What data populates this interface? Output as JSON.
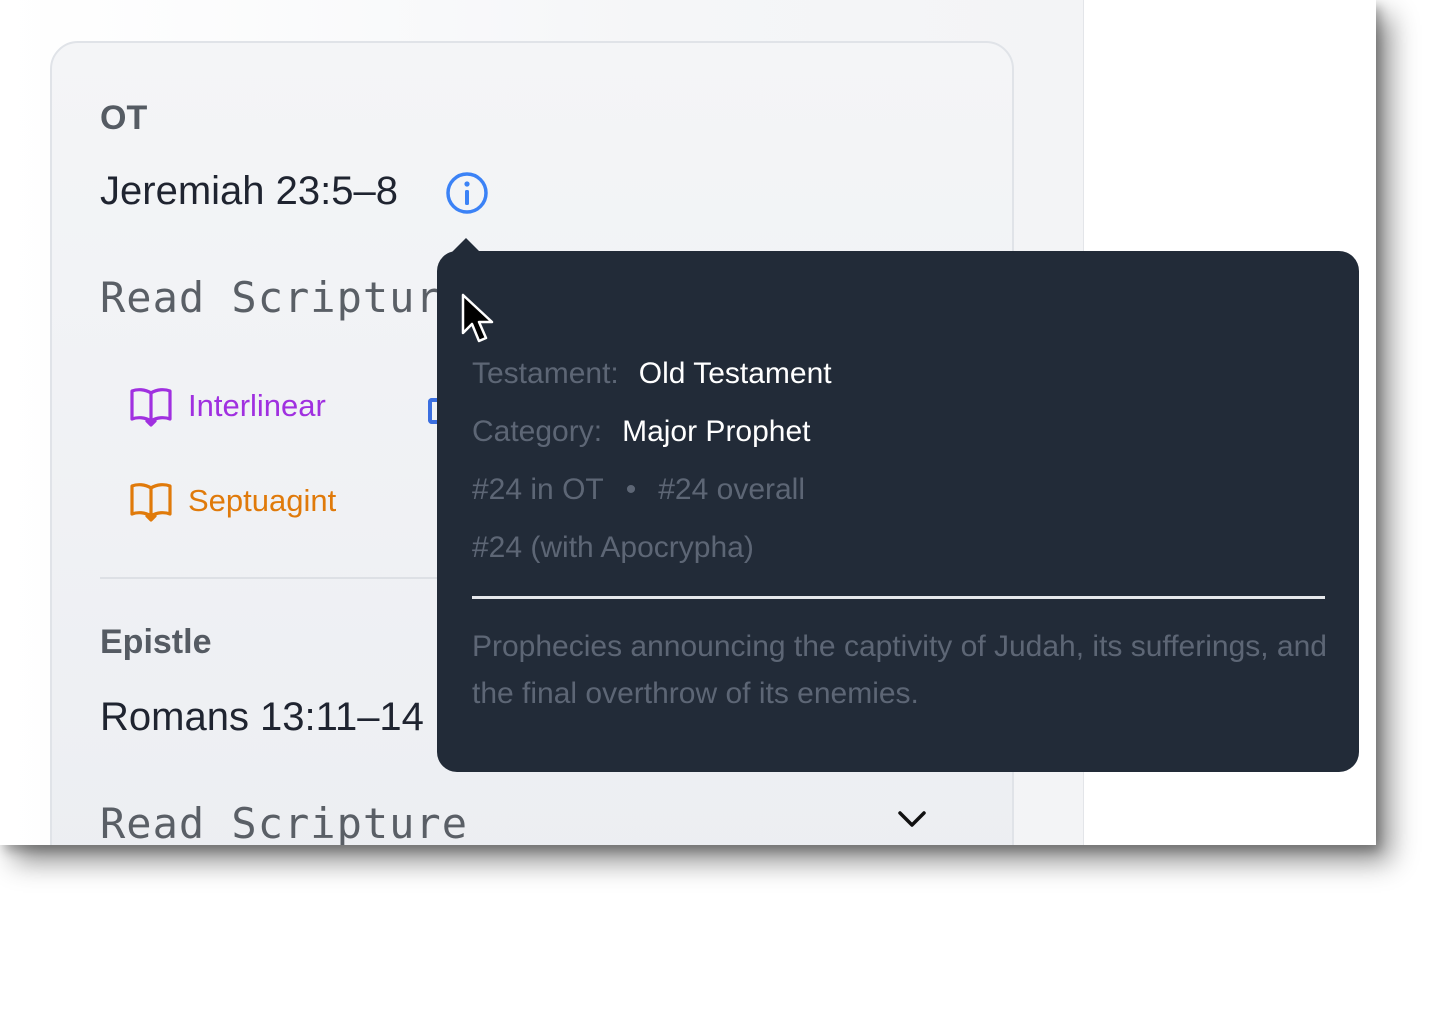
{
  "sections": [
    {
      "label": "OT",
      "reading": "Jeremiah 23:5–8",
      "read_label": "Read Scripture",
      "links": [
        {
          "label": "Interlinear",
          "icon": "book-open-icon",
          "color": "#a030e0"
        },
        {
          "label": "Septuagint",
          "icon": "book-open-icon",
          "color": "#e07a0a"
        }
      ]
    },
    {
      "label": "Epistle",
      "reading": "Romans 13:11–14",
      "read_label": "Read Scripture"
    }
  ],
  "tooltip": {
    "testament_label": "Testament:",
    "testament_value": "Old Testament",
    "category_label": "Category:",
    "category_value": "Major Prophet",
    "rank_ot": "#24 in OT",
    "separator": "•",
    "rank_overall": "#24 overall",
    "rank_apocrypha": "#24 (with Apocrypha)",
    "description": "Prophecies announcing the captivity of Judah, its sufferings, and the final overthrow of its enemies."
  },
  "colors": {
    "tooltip_bg": "#222b38",
    "info_icon": "#3b82f6"
  }
}
